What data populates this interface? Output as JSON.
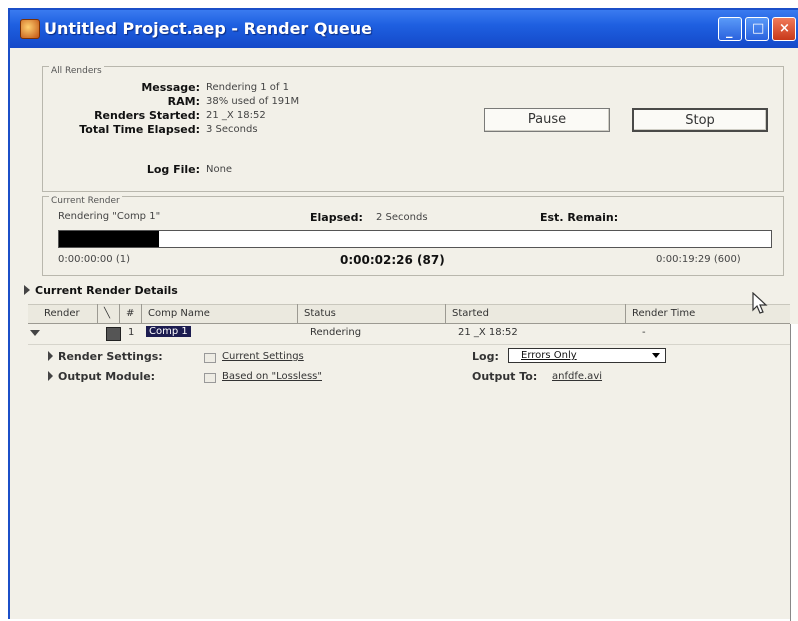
{
  "window": {
    "title": "Untitled Project.aep - Render Queue"
  },
  "all_renders": {
    "group_label": "All Renders",
    "message_label": "Message:",
    "message_value": "Rendering 1 of 1",
    "ram_label": "RAM:",
    "ram_value": "38% used of 191M",
    "renders_started_label": "Renders Started:",
    "renders_started_value": "21 _X 18:52",
    "total_time_label": "Total Time Elapsed:",
    "total_time_value": "3 Seconds",
    "log_file_label": "Log File:",
    "log_file_value": "None",
    "pause_label": "Pause",
    "stop_label": "Stop"
  },
  "current_render": {
    "group_label": "Current Render",
    "rendering_text": "Rendering \"Comp 1\"",
    "elapsed_label": "Elapsed:",
    "elapsed_value": "2 Seconds",
    "est_remain_label": "Est. Remain:",
    "progress_fraction": 0.14,
    "start_time": "0:00:00:00 (1)",
    "current_time": "0:00:02:26 (87)",
    "end_time": "0:00:19:29 (600)"
  },
  "details": {
    "header": "Current Render Details"
  },
  "columns": [
    "Render",
    "#",
    "Comp Name",
    "Status",
    "Started",
    "Render Time"
  ],
  "row": {
    "number": "1",
    "comp_name": "Comp 1",
    "status": "Rendering",
    "started": "21 _X 18:52",
    "render_time": "-",
    "render_settings_label": "Render Settings:",
    "render_settings_value": "Current Settings",
    "log_label": "Log:",
    "log_value": "Errors Only",
    "output_module_label": "Output Module:",
    "output_module_value": "Based on \"Lossless\"",
    "output_to_label": "Output To:",
    "output_to_value": "anfdfe.avi"
  },
  "colors": {
    "titlebar": "#1e5fe0",
    "window_bg": "#f2f0e8",
    "selection": "#1c1c50",
    "progress": "#000000"
  }
}
